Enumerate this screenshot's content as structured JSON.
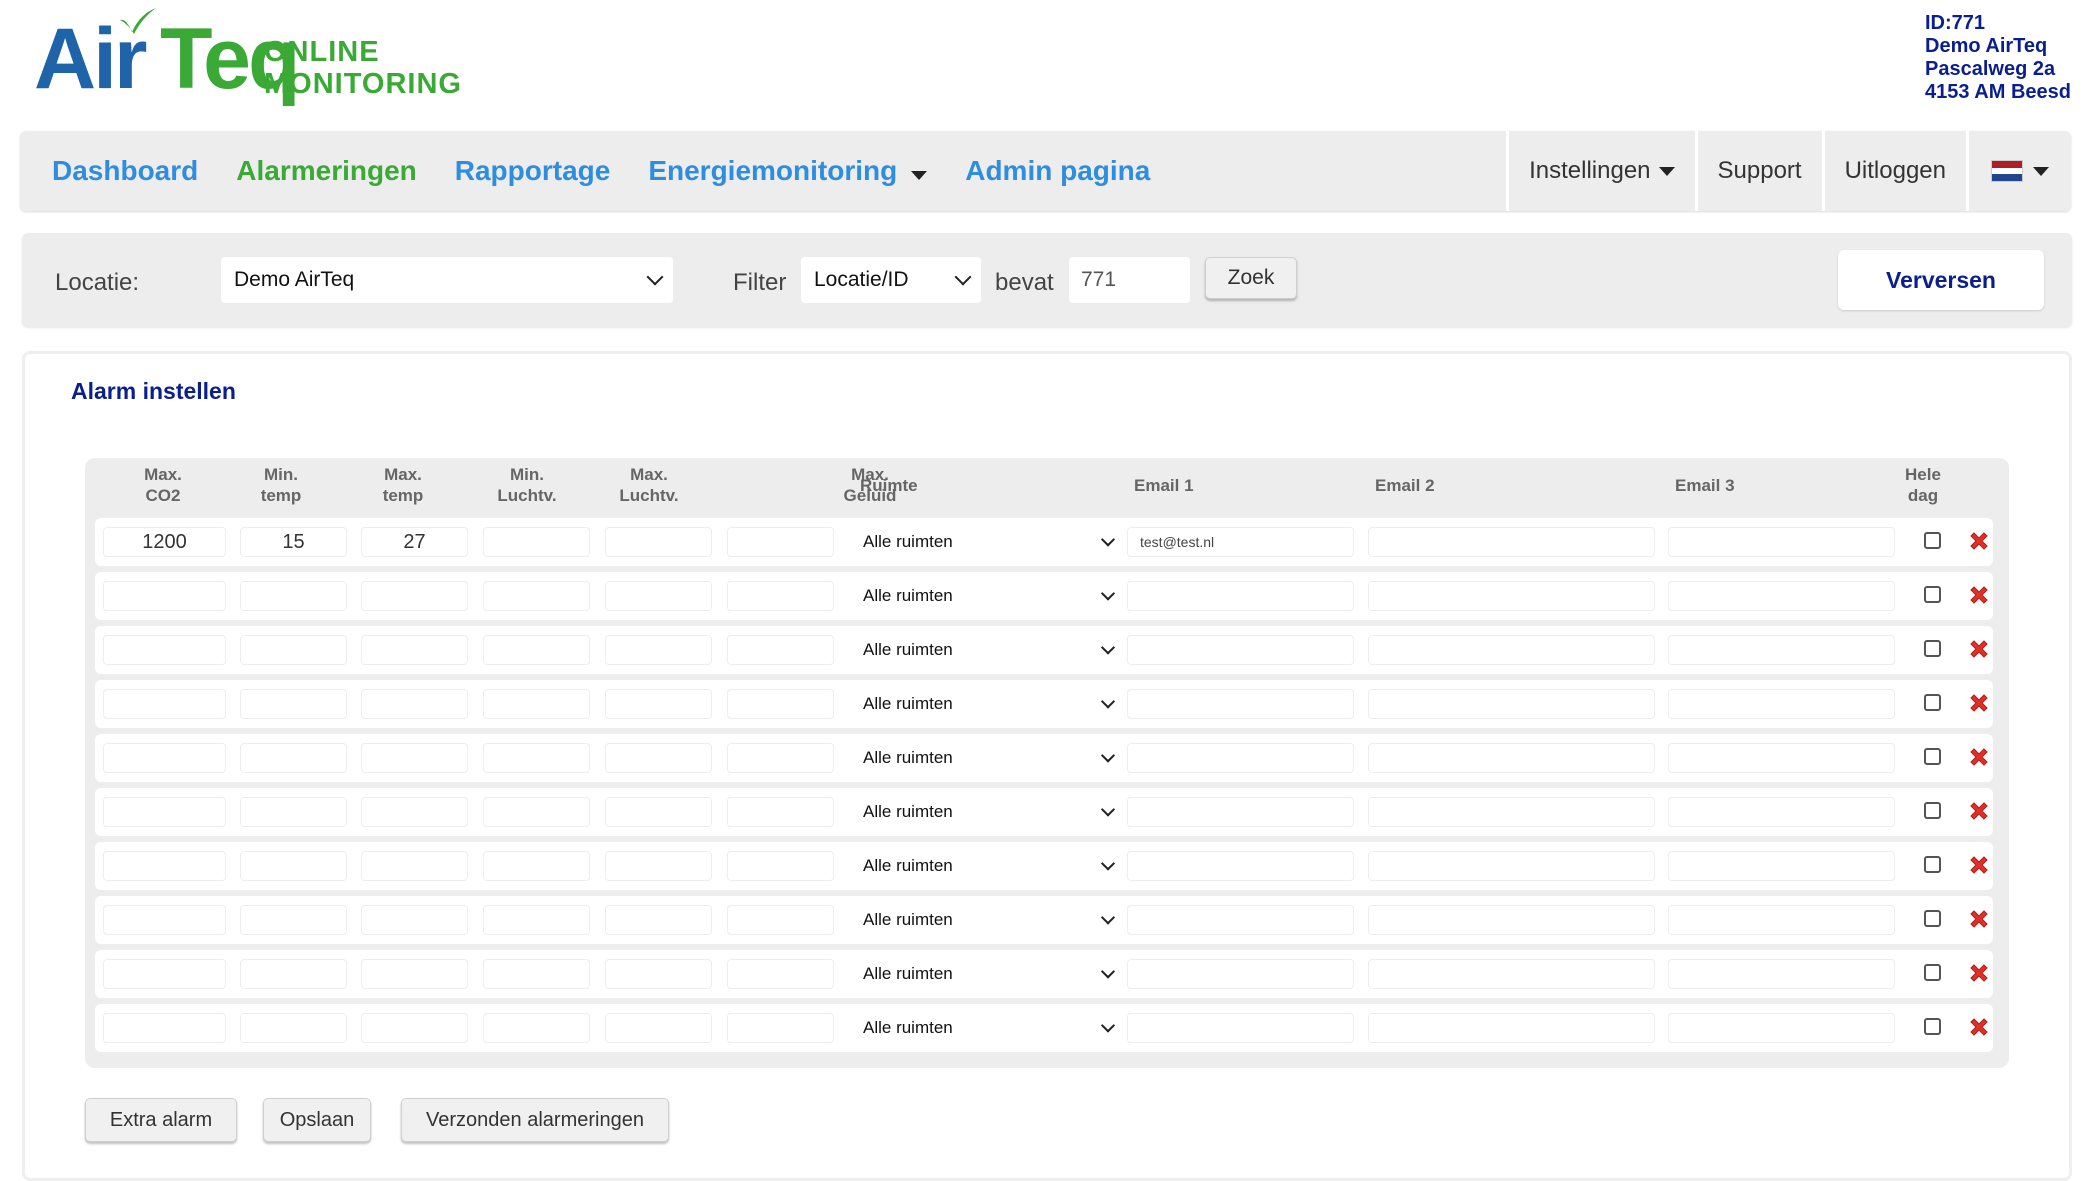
{
  "brand": {
    "name_part1": "Air",
    "name_part2": "Teq",
    "tagline_line1": "ONLINE",
    "tagline_line2": "MONITORING",
    "colors": {
      "blue": "#1f63a8",
      "green": "#3aa935",
      "navy": "#0a1f8f",
      "link_blue": "#2f8ddf",
      "delete_red": "#e0302a"
    }
  },
  "address": {
    "id": "ID:771",
    "name": "Demo AirTeq",
    "street": "Pascalweg 2a",
    "city": "4153 AM Beesd"
  },
  "nav": {
    "left": [
      {
        "label": "Dashboard",
        "active": false
      },
      {
        "label": "Alarmeringen",
        "active": true
      },
      {
        "label": "Rapportage",
        "active": false
      },
      {
        "label": "Energiemonitoring",
        "active": false,
        "dropdown": true
      },
      {
        "label": "Admin pagina",
        "active": false
      }
    ],
    "settings": "Instellingen",
    "support": "Support",
    "logout": "Uitloggen",
    "language_icon": "flag-nl-icon"
  },
  "filter": {
    "location_label": "Locatie:",
    "location_value": "Demo AirTeq",
    "filter_label": "Filter",
    "filter_value": "Locatie/ID",
    "contains_label": "bevat",
    "search_value": "771",
    "search_button": "Zoek",
    "refresh_button": "Verversen"
  },
  "alarm": {
    "title": "Alarm instellen",
    "columns": {
      "max_co2_1": "Max.",
      "max_co2_2": "CO2",
      "min_temp_1": "Min.",
      "min_temp_2": "temp",
      "max_temp_1": "Max.",
      "max_temp_2": "temp",
      "min_hum_1": "Min.",
      "min_hum_2": "Luchtv.",
      "max_hum_1": "Max.",
      "max_hum_2": "Luchtv.",
      "max_noise_1": "Max.",
      "max_noise_2": "Geluid",
      "room": "Ruimte",
      "email1": "Email 1",
      "email2": "Email 2",
      "email3": "Email 3",
      "allday_1": "Hele",
      "allday_2": "dag"
    },
    "rows": [
      {
        "max_co2": "1200",
        "min_temp": "15",
        "max_temp": "27",
        "min_hum": "",
        "max_hum": "",
        "max_noise": "",
        "room": "Alle ruimten",
        "email1": "test@test.nl",
        "email2": "",
        "email3": "",
        "all_day": false
      },
      {
        "max_co2": "",
        "min_temp": "",
        "max_temp": "",
        "min_hum": "",
        "max_hum": "",
        "max_noise": "",
        "room": "Alle ruimten",
        "email1": "",
        "email2": "",
        "email3": "",
        "all_day": false
      },
      {
        "max_co2": "",
        "min_temp": "",
        "max_temp": "",
        "min_hum": "",
        "max_hum": "",
        "max_noise": "",
        "room": "Alle ruimten",
        "email1": "",
        "email2": "",
        "email3": "",
        "all_day": false
      },
      {
        "max_co2": "",
        "min_temp": "",
        "max_temp": "",
        "min_hum": "",
        "max_hum": "",
        "max_noise": "",
        "room": "Alle ruimten",
        "email1": "",
        "email2": "",
        "email3": "",
        "all_day": false
      },
      {
        "max_co2": "",
        "min_temp": "",
        "max_temp": "",
        "min_hum": "",
        "max_hum": "",
        "max_noise": "",
        "room": "Alle ruimten",
        "email1": "",
        "email2": "",
        "email3": "",
        "all_day": false
      },
      {
        "max_co2": "",
        "min_temp": "",
        "max_temp": "",
        "min_hum": "",
        "max_hum": "",
        "max_noise": "",
        "room": "Alle ruimten",
        "email1": "",
        "email2": "",
        "email3": "",
        "all_day": false
      },
      {
        "max_co2": "",
        "min_temp": "",
        "max_temp": "",
        "min_hum": "",
        "max_hum": "",
        "max_noise": "",
        "room": "Alle ruimten",
        "email1": "",
        "email2": "",
        "email3": "",
        "all_day": false
      },
      {
        "max_co2": "",
        "min_temp": "",
        "max_temp": "",
        "min_hum": "",
        "max_hum": "",
        "max_noise": "",
        "room": "Alle ruimten",
        "email1": "",
        "email2": "",
        "email3": "",
        "all_day": false
      },
      {
        "max_co2": "",
        "min_temp": "",
        "max_temp": "",
        "min_hum": "",
        "max_hum": "",
        "max_noise": "",
        "room": "Alle ruimten",
        "email1": "",
        "email2": "",
        "email3": "",
        "all_day": false
      },
      {
        "max_co2": "",
        "min_temp": "",
        "max_temp": "",
        "min_hum": "",
        "max_hum": "",
        "max_noise": "",
        "room": "Alle ruimten",
        "email1": "",
        "email2": "",
        "email3": "",
        "all_day": false
      }
    ],
    "buttons": {
      "extra": "Extra alarm",
      "save": "Opslaan",
      "sent": "Verzonden alarmeringen"
    }
  }
}
